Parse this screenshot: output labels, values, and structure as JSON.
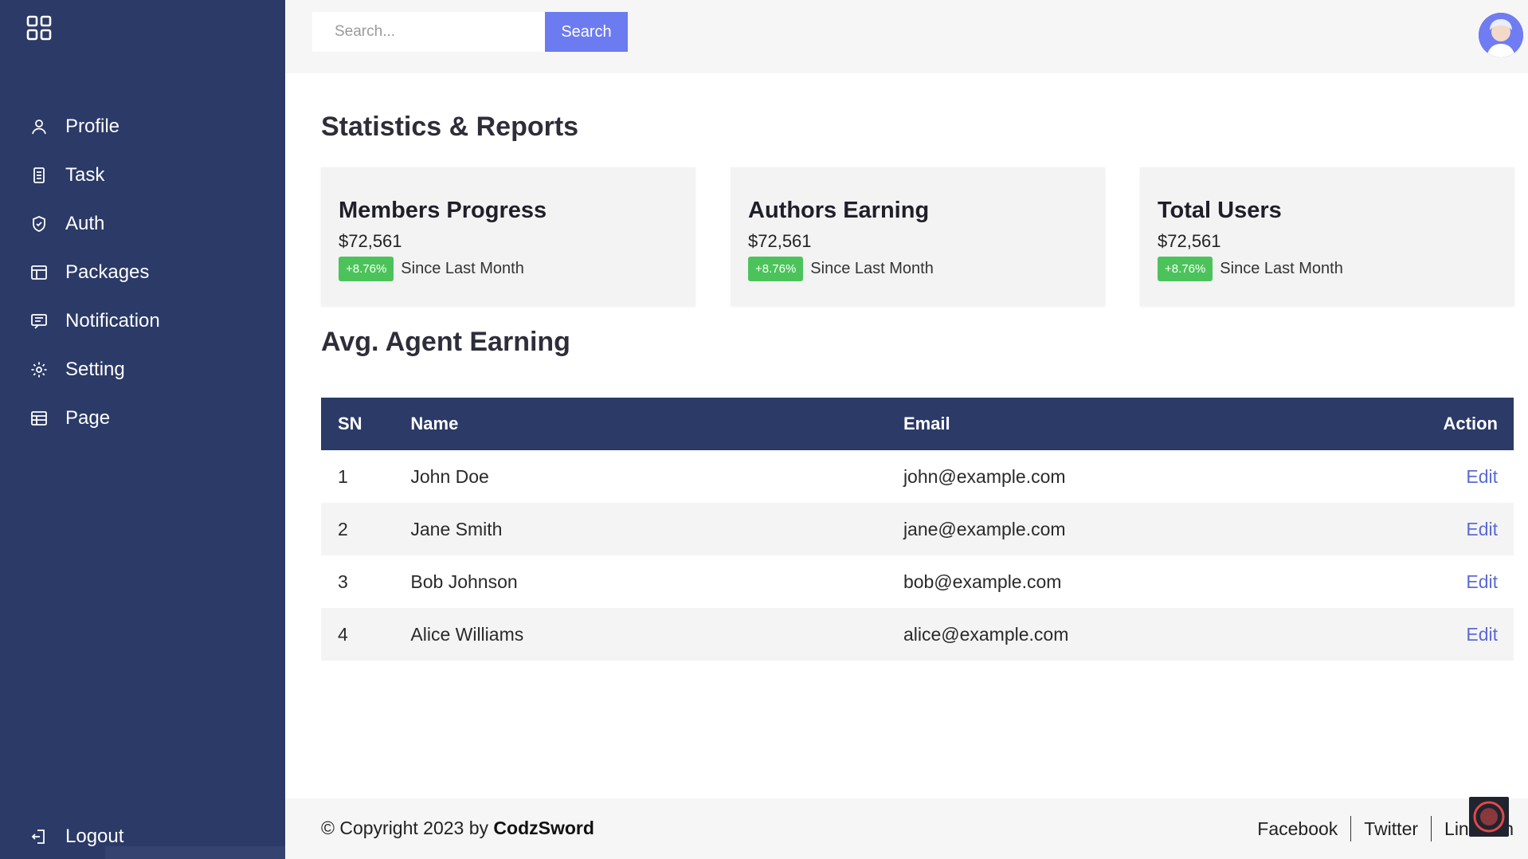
{
  "header": {
    "search": {
      "placeholder": "Search...",
      "value": ""
    },
    "search_button_label": "Search"
  },
  "sidebar": {
    "items": [
      {
        "label": "Profile",
        "icon": "user-icon"
      },
      {
        "label": "Task",
        "icon": "task-icon"
      },
      {
        "label": "Auth",
        "icon": "shield-icon"
      },
      {
        "label": "Packages",
        "icon": "packages-icon"
      },
      {
        "label": "Notification",
        "icon": "notification-icon"
      },
      {
        "label": "Setting",
        "icon": "gear-icon"
      },
      {
        "label": "Page",
        "icon": "page-icon"
      }
    ],
    "logout_label": "Logout"
  },
  "main": {
    "stats_title": "Statistics & Reports",
    "stat_cards": [
      {
        "title": "Members Progress",
        "value": "$72,561",
        "badge": "+8.76%",
        "since": "Since Last Month"
      },
      {
        "title": "Authors Earning",
        "value": "$72,561",
        "badge": "+8.76%",
        "since": "Since Last Month"
      },
      {
        "title": "Total Users",
        "value": "$72,561",
        "badge": "+8.76%",
        "since": "Since Last Month"
      }
    ],
    "table_title": "Avg. Agent Earning",
    "table": {
      "headers": [
        "SN",
        "Name",
        "Email",
        "Action"
      ],
      "rows": [
        {
          "sn": "1",
          "name": "John Doe",
          "email": "john@example.com",
          "action": "Edit"
        },
        {
          "sn": "2",
          "name": "Jane Smith",
          "email": "jane@example.com",
          "action": "Edit"
        },
        {
          "sn": "3",
          "name": "Bob Johnson",
          "email": "bob@example.com",
          "action": "Edit"
        },
        {
          "sn": "4",
          "name": "Alice Williams",
          "email": "alice@example.com",
          "action": "Edit"
        }
      ]
    }
  },
  "footer": {
    "copyright_prefix": "© Copyright 2023 by",
    "brand": "CodzSword",
    "links": [
      "Facebook",
      "Twitter",
      "LinkedIn"
    ]
  },
  "colors": {
    "sidebar_bg": "#2b3a67",
    "accent": "#6c7bf0",
    "badge_green": "#4cc35a",
    "link": "#5b6bd6"
  }
}
